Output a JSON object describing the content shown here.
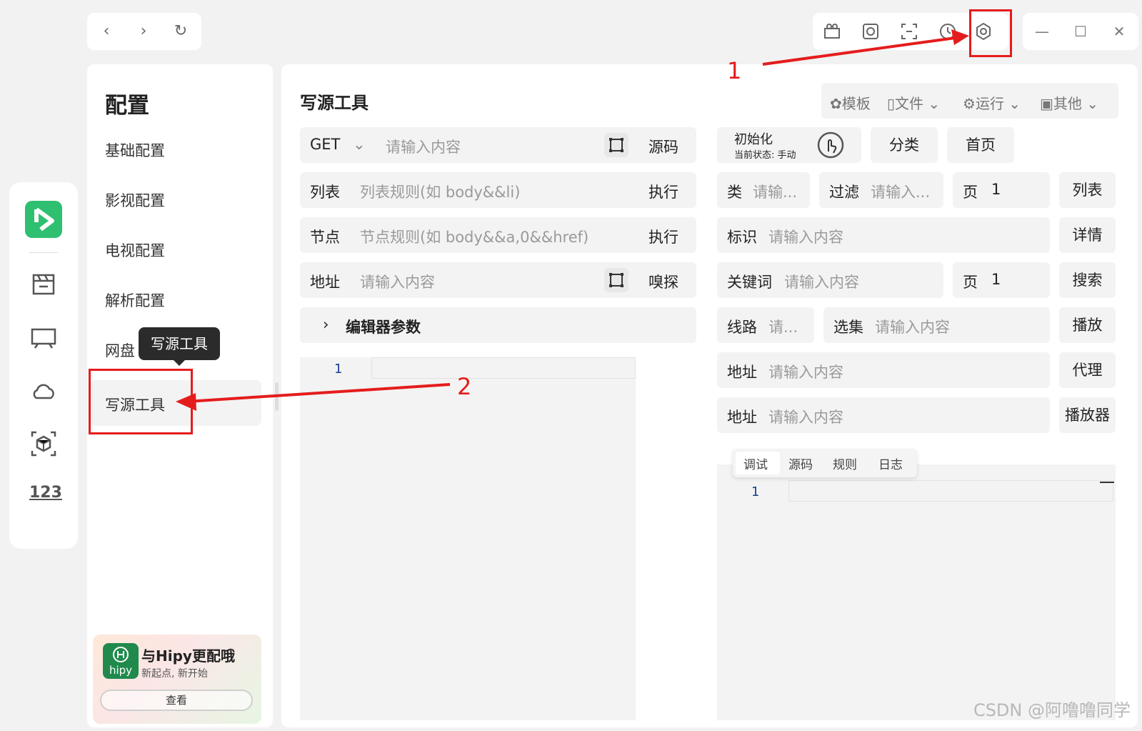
{
  "nav": {
    "back_icon": "‹",
    "forward_icon": "›",
    "refresh_icon": "↻"
  },
  "toolbar": {
    "icons": [
      "cinema-icon",
      "disc-icon",
      "scan-icon",
      "history-icon",
      "settings-icon"
    ]
  },
  "window": {
    "minimize": "—",
    "maximize": "☐",
    "close": "✕"
  },
  "sidebar_rail": {
    "icons": [
      "app-logo-icon",
      "movie-icon",
      "tv-icon",
      "cloud-icon",
      "box-icon",
      "numbers-icon"
    ],
    "numbers_label": "123"
  },
  "config": {
    "title": "配置",
    "items": [
      "基础配置",
      "影视配置",
      "电视配置",
      "解析配置",
      "网盘配置",
      "写源工具"
    ],
    "active_item_partial": "网盘",
    "tooltip": "写源工具",
    "promo": {
      "logo_text": "hipy",
      "title": "与Hipy更配哦",
      "subtitle": "新起点, 新开始",
      "button": "查看"
    }
  },
  "main": {
    "title": "写源工具",
    "menu": {
      "template": "模板",
      "file": "文件",
      "run": "运行",
      "other": "其他"
    },
    "request": {
      "method": "GET",
      "url_placeholder": "请输入内容",
      "source_btn": "源码"
    },
    "init": {
      "label": "初始化",
      "status": "当前状态: 手动"
    },
    "buttons": {
      "category": "分类",
      "home": "首页",
      "list": "列表",
      "detail": "详情",
      "search": "搜索",
      "play": "播放",
      "proxy": "代理",
      "player": "播放器"
    },
    "rows": {
      "list_label": "列表",
      "list_placeholder": "列表规则(如 body&&li)",
      "list_exec": "执行",
      "node_label": "节点",
      "node_placeholder": "节点规则(如 body&&a,0&&href)",
      "node_exec": "执行",
      "addr_label": "地址",
      "addr_placeholder": "请输入内容",
      "sniff": "嗅探",
      "editor_params": "编辑器参数",
      "class_label": "类",
      "class_placeholder": "请输...",
      "filter_label": "过滤",
      "filter_placeholder": "请输入...",
      "page_label": "页",
      "page_value": "1",
      "ident_label": "标识",
      "ident_placeholder": "请输入内容",
      "keyword_label": "关键词",
      "keyword_placeholder": "请输入内容",
      "page2_label": "页",
      "page2_value": "1",
      "line_label": "线路",
      "line_placeholder": "请...",
      "episode_label": "选集",
      "episode_placeholder": "请输入内容",
      "addr2_label": "地址",
      "addr2_placeholder": "请输入内容",
      "addr3_label": "地址",
      "addr3_placeholder": "请输入内容"
    },
    "editor_line_no": "1",
    "tabs": [
      "调试",
      "源码",
      "规则",
      "日志"
    ],
    "output_line_no": "1"
  },
  "annotations": {
    "num1": "1",
    "num2": "2",
    "color": "#e51c1c"
  },
  "watermark": "CSDN @阿噜噜同学"
}
